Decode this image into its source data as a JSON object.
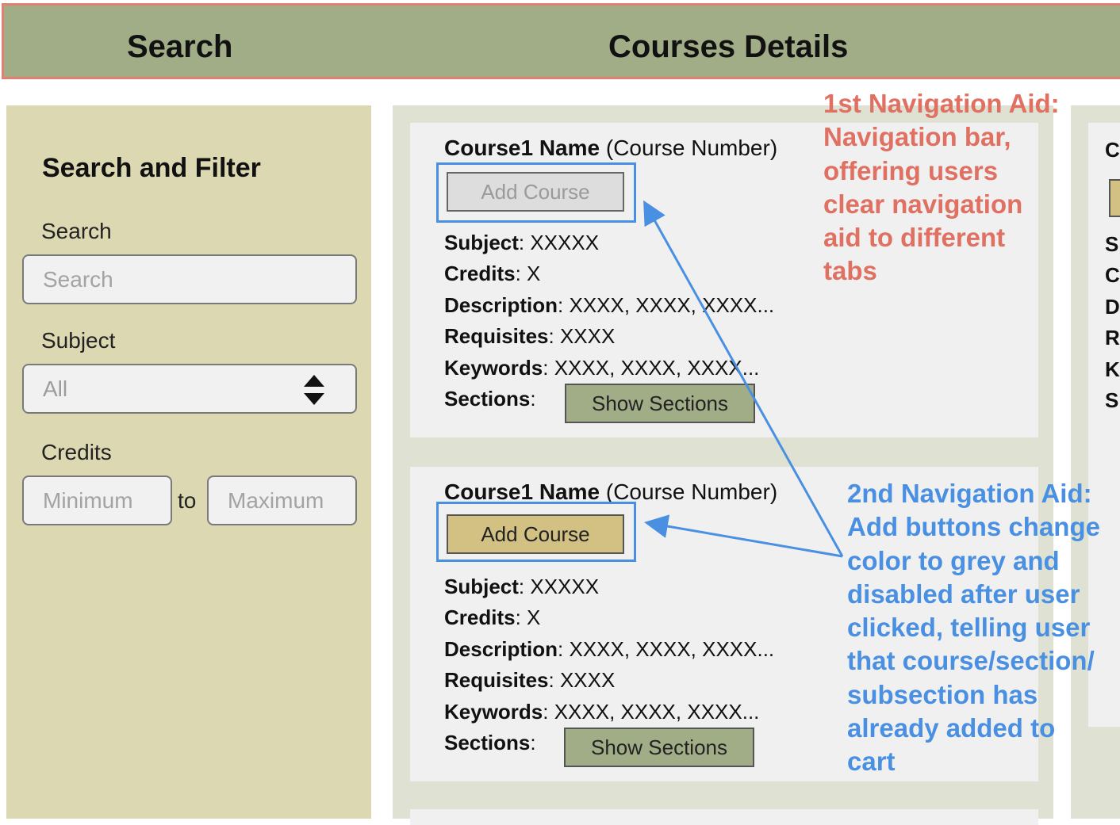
{
  "nav": {
    "tabs": [
      {
        "label": "Search"
      },
      {
        "label": "Courses Details"
      }
    ]
  },
  "sidebar": {
    "title": "Search and Filter",
    "search": {
      "label": "Search",
      "placeholder": "Search"
    },
    "subject": {
      "label": "Subject",
      "selected": "All"
    },
    "credits": {
      "label": "Credits",
      "min_placeholder": "Minimum",
      "to_label": "to",
      "max_placeholder": "Maximum"
    }
  },
  "courses": [
    {
      "name": "Course1 Name",
      "number": "(Course Number)",
      "add_label": "Add Course",
      "add_state": "disabled",
      "subject_label": "Subject",
      "subject": "XXXXX",
      "credits_label": "Credits",
      "credits": "X",
      "description_label": "Description",
      "description": "XXXX, XXXX, XXXX...",
      "requisites_label": "Requisites",
      "requisites": "XXXX",
      "keywords_label": "Keywords",
      "keywords": "XXXX, XXXX, XXXX...",
      "sections_label": "Sections",
      "sections_button": "Show Sections"
    },
    {
      "name": "Course1 Name",
      "number": "(Course Number)",
      "add_label": "Add Course",
      "add_state": "active",
      "subject_label": "Subject",
      "subject": "XXXXX",
      "credits_label": "Credits",
      "credits": "X",
      "description_label": "Description",
      "description": "XXXX, XXXX, XXXX...",
      "requisites_label": "Requisites",
      "requisites": "XXXX",
      "keywords_label": "Keywords",
      "keywords": "XXXX, XXXX, XXXX...",
      "sections_label": "Sections",
      "sections_button": "Show Sections"
    }
  ],
  "annotations": {
    "first": "1st Navigation Aid:\nNavigation bar,\noffering users\nclear navigation\naid to different\ntabs",
    "second": "2nd Navigation Aid:\nAdd buttons change\ncolor to grey and\ndisabled after user\nclicked, telling user\nthat course/section/\nsubsection has\nalready added to\ncart"
  },
  "peek_letters": [
    "C",
    "S",
    "C",
    "D",
    "R",
    "K",
    "S"
  ],
  "colors": {
    "nav_bg": "#a1ad86",
    "nav_border": "#e07f72",
    "sidebar_bg": "#dcd8b1",
    "add_active": "#d3c184",
    "add_disabled": "#dddddd",
    "annotation_red": "#e07062",
    "annotation_blue": "#4a90e2"
  },
  "icons": {
    "select_arrows": "up-down-triangles-icon"
  }
}
